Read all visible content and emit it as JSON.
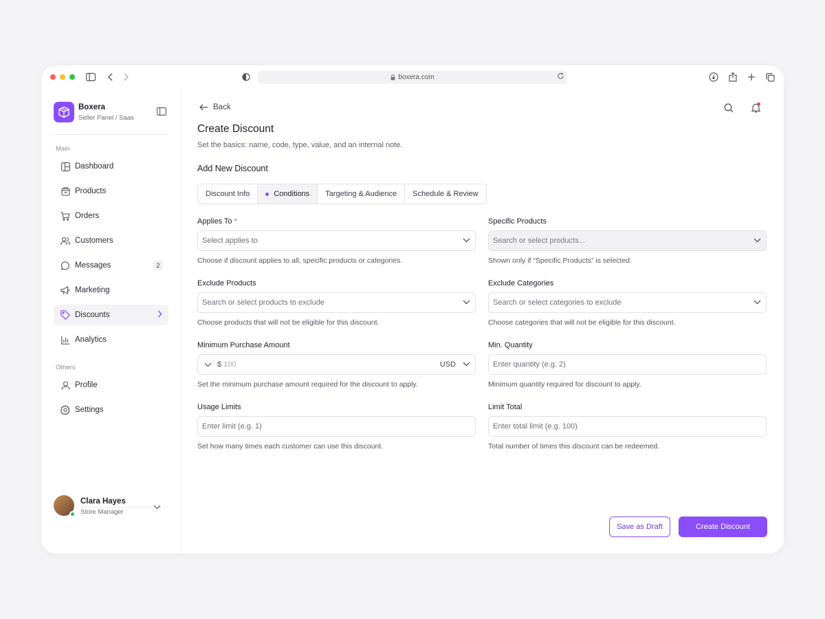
{
  "browser": {
    "url": "boxera.com"
  },
  "brand": {
    "name": "Boxera",
    "subtitle": "Seller Panel / Saas"
  },
  "sidebar": {
    "section_main": "Main",
    "section_others": "Others",
    "items": [
      {
        "label": "Dashboard",
        "icon": "dashboard-icon"
      },
      {
        "label": "Products",
        "icon": "box-icon"
      },
      {
        "label": "Orders",
        "icon": "cart-icon"
      },
      {
        "label": "Customers",
        "icon": "users-icon"
      },
      {
        "label": "Messages",
        "icon": "chat-icon",
        "badge": "2"
      },
      {
        "label": "Marketing",
        "icon": "megaphone-icon"
      },
      {
        "label": "Discounts",
        "icon": "tag-icon",
        "active": true
      },
      {
        "label": "Analytics",
        "icon": "bar-chart-icon"
      }
    ],
    "others": [
      {
        "label": "Profile",
        "icon": "user-icon"
      },
      {
        "label": "Settings",
        "icon": "gear-icon"
      }
    ]
  },
  "user": {
    "name": "Clara Hayes",
    "role": "Store Manager"
  },
  "header": {
    "back_label": "Back",
    "title": "Create Discount",
    "subtitle": "Set the basics: name, code, type, value, and an internal note.",
    "section_title": "Add New Discount"
  },
  "tabs": [
    {
      "label": "Discount Info"
    },
    {
      "label": "Conditions",
      "active": true
    },
    {
      "label": "Targeting & Audience"
    },
    {
      "label": "Schedule & Review"
    }
  ],
  "form": {
    "applies_to": {
      "label": "Applies To",
      "required_mark": "*",
      "placeholder": "Select applies to",
      "help": "Choose if discount applies to all, specific products or categories."
    },
    "specific_products": {
      "label": "Specific Products",
      "placeholder": "Search or select products...",
      "help": "Shown only if “Specific Products” is selected."
    },
    "exclude_products": {
      "label": "Exclude Products",
      "placeholder": "Search or select products to exclude",
      "help": "Choose products that will not be eligible for this discount."
    },
    "exclude_categories": {
      "label": "Exclude Categories",
      "placeholder": "Search or select categories to exclude",
      "help": "Choose categories that will not be eligible for this discount."
    },
    "min_purchase": {
      "label": "Minimum Purchase Amount",
      "prefix": "$",
      "placeholder": "100",
      "currency": "USD",
      "help": "Set the minimum purchase amount required for the discount to apply."
    },
    "min_quantity": {
      "label": "Min. Quantity",
      "placeholder": "Enter quantity (e.g. 2)",
      "help": "Minimum quantity required for discount to apply."
    },
    "usage_limits": {
      "label": "Usage Limits",
      "placeholder": "Enter limit (e.g. 1)",
      "help": "Set how many times each customer can use this discount."
    },
    "limit_total": {
      "label": "Limit Total",
      "placeholder": "Enter total limit (e.g. 100)",
      "help": "Total number of times this discount can be redeemed."
    }
  },
  "actions": {
    "save_draft": "Save as Draft",
    "create": "Create Discount"
  },
  "colors": {
    "accent": "#8a4dfa",
    "online": "#22c55e",
    "notification": "#ef4444"
  }
}
